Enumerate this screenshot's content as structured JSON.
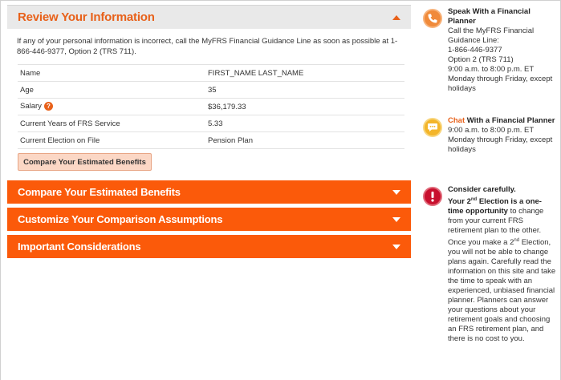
{
  "review": {
    "title": "Review Your Information",
    "intro": "If any of your personal information is incorrect, call the MyFRS Financial Guidance Line as soon as possible at 1-866-446-9377, Option 2 (TRS 711).",
    "rows": [
      {
        "label": "Name",
        "value": "FIRST_NAME LAST_NAME"
      },
      {
        "label": "Age",
        "value": "35"
      },
      {
        "label": "Salary",
        "value": "$36,179.33"
      },
      {
        "label": "Current Years of FRS Service",
        "value": "5.33"
      },
      {
        "label": "Current Election on File",
        "value": "Pension Plan"
      }
    ],
    "help_glyph": "?",
    "compare_button": "Compare Your Estimated Benefits"
  },
  "accordions": [
    {
      "label": "Compare Your Estimated Benefits"
    },
    {
      "label": "Customize Your Comparison Assumptions"
    },
    {
      "label": "Important Considerations"
    }
  ],
  "sidebar": {
    "phone": {
      "icon": "phone-icon",
      "title": "Speak With a Financial Planner",
      "body": "Call the MyFRS Financial Guidance Line:",
      "number": "1-866-446-9377",
      "option": "Option 2 (TRS 711)",
      "hours": "9:00 a.m. to 8:00 p.m. ET",
      "days": "Monday through Friday, except holidays"
    },
    "chat": {
      "icon": "chat-icon",
      "link": "Chat",
      "title_rest": "With a Financial Planner",
      "hours": "9:00 a.m. to 8:00 p.m. ET",
      "days": "Monday through Friday, except holidays"
    },
    "warning": {
      "icon": "alert-icon",
      "heading": "Consider carefully.",
      "bold_a": "Your 2",
      "sup_a": "nd",
      "bold_b": " Election is a one-time opportunity",
      "text_a": " to change from your current FRS retirement plan to the other. Once you make a 2",
      "sup_b": "nd",
      "text_b": " Election, you will not be able to change plans again. Carefully read the information on this site and take the time to speak with an experienced, unbiased financial planner. Planners can answer your questions about your retirement goals and choosing an FRS retirement plan, and there is no cost to you."
    }
  },
  "colors": {
    "accent": "#fb5a0a",
    "title_orange": "#e8611a",
    "header_gray": "#e9e9e9",
    "button_fill": "#fbd7c5"
  }
}
